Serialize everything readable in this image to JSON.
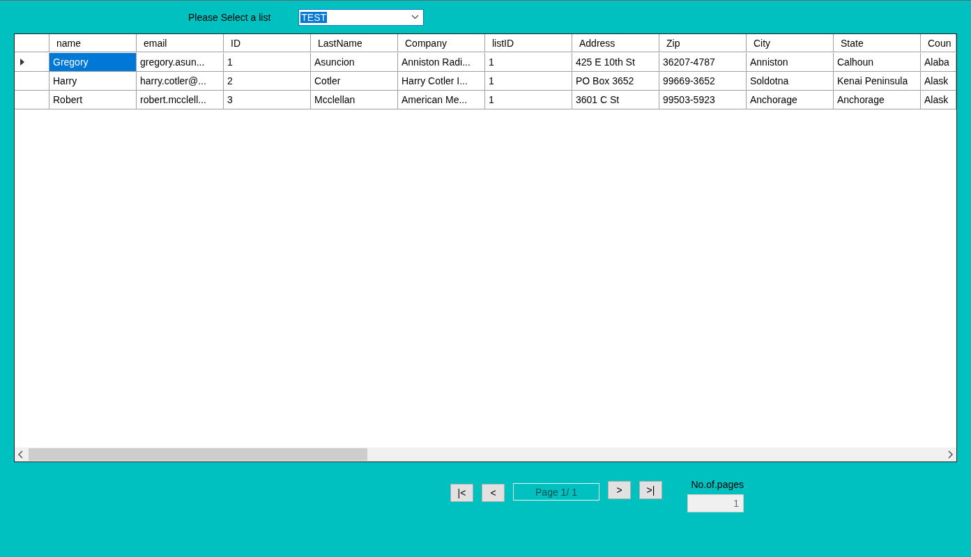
{
  "list_picker": {
    "label": "Please Select a list",
    "value": "TEST"
  },
  "table": {
    "columns": [
      "name",
      "email",
      "ID",
      "LastName",
      "Company",
      "listID",
      "Address",
      "Zip",
      "City",
      "State",
      "Coun"
    ],
    "rows": [
      {
        "current": true,
        "cells": [
          {
            "text": "Gregory",
            "selected": true
          },
          {
            "text": "gregory.asun...",
            "selected": false
          },
          {
            "text": "1",
            "selected": false
          },
          {
            "text": "Asuncion",
            "selected": false
          },
          {
            "text": "Anniston Radi...",
            "selected": false
          },
          {
            "text": "1",
            "selected": false
          },
          {
            "text": "425 E 10th St",
            "selected": false
          },
          {
            "text": "36207-4787",
            "selected": false
          },
          {
            "text": "Anniston",
            "selected": false
          },
          {
            "text": "Calhoun",
            "selected": false
          },
          {
            "text": "Alaba",
            "selected": false
          }
        ]
      },
      {
        "current": false,
        "cells": [
          {
            "text": "Harry",
            "selected": false
          },
          {
            "text": "harry.cotler@...",
            "selected": false
          },
          {
            "text": "2",
            "selected": false
          },
          {
            "text": "Cotler",
            "selected": false
          },
          {
            "text": "Harry Cotler I...",
            "selected": false
          },
          {
            "text": "1",
            "selected": false
          },
          {
            "text": "PO Box 3652",
            "selected": false
          },
          {
            "text": "99669-3652",
            "selected": false
          },
          {
            "text": "Soldotna",
            "selected": false
          },
          {
            "text": "Kenai Peninsula",
            "selected": false
          },
          {
            "text": "Alask",
            "selected": false
          }
        ]
      },
      {
        "current": false,
        "cells": [
          {
            "text": "Robert",
            "selected": false
          },
          {
            "text": "robert.mcclell...",
            "selected": false
          },
          {
            "text": "3",
            "selected": false
          },
          {
            "text": "Mcclellan",
            "selected": false
          },
          {
            "text": "American Me...",
            "selected": false
          },
          {
            "text": "1",
            "selected": false
          },
          {
            "text": "3601 C St",
            "selected": false
          },
          {
            "text": "99503-5923",
            "selected": false
          },
          {
            "text": "Anchorage",
            "selected": false
          },
          {
            "text": "Anchorage",
            "selected": false
          },
          {
            "text": "Alask",
            "selected": false
          }
        ]
      }
    ]
  },
  "pager": {
    "first": "|<",
    "prev": "<",
    "page_label": "Page 1/ 1",
    "next": ">",
    "last": ">|",
    "pages_label": "No.of.pages",
    "pages_value": "1"
  }
}
